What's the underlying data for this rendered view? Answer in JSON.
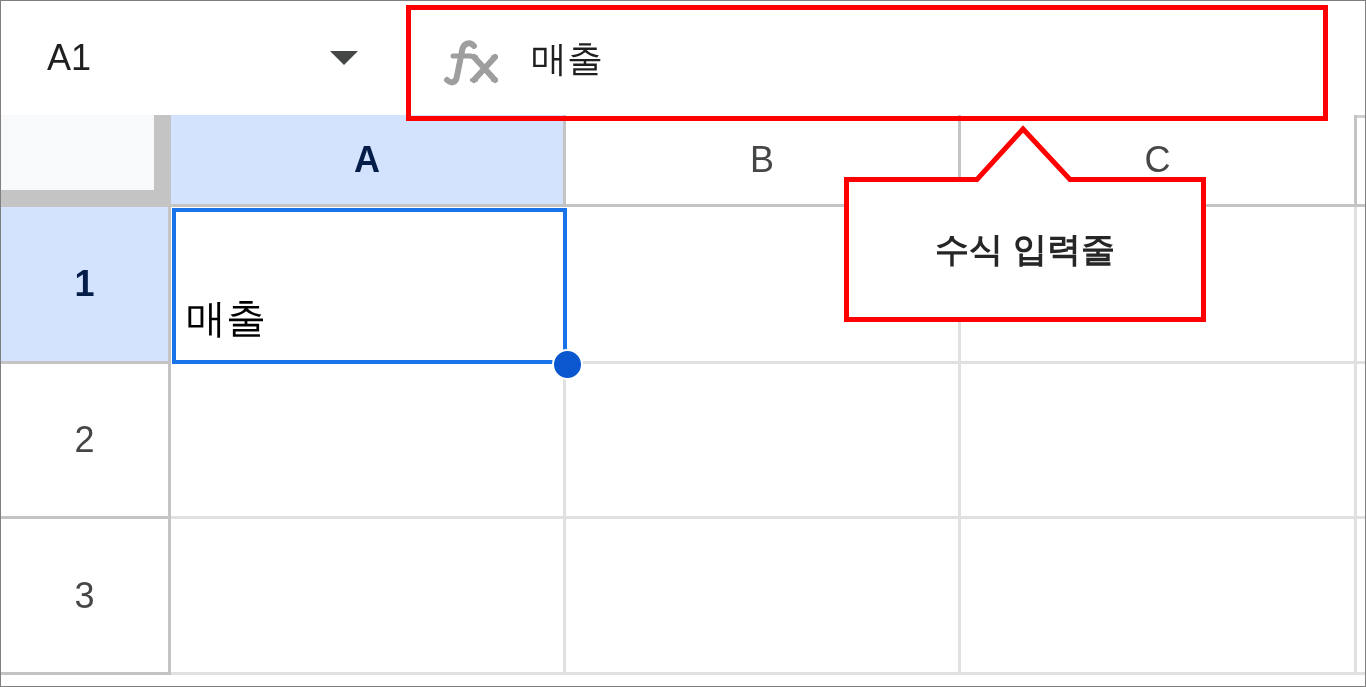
{
  "name_box": {
    "value": "A1"
  },
  "formula_bar": {
    "value": "매출",
    "highlighted": true
  },
  "columns": [
    {
      "label": "A",
      "selected": true
    },
    {
      "label": "B",
      "selected": false
    },
    {
      "label": "C",
      "selected": false
    }
  ],
  "rows": [
    {
      "label": "1",
      "selected": true,
      "cells": [
        {
          "value": "매출",
          "selected": true
        },
        {
          "selected": false
        },
        {
          "selected": false
        }
      ]
    },
    {
      "label": "2",
      "selected": false,
      "cells": [
        {
          "selected": false
        },
        {
          "selected": false
        },
        {
          "selected": false
        }
      ]
    },
    {
      "label": "3",
      "selected": false,
      "cells": [
        {
          "selected": false
        },
        {
          "selected": false
        },
        {
          "selected": false
        }
      ]
    }
  ],
  "callout": {
    "text": "수식 입력줄"
  }
}
